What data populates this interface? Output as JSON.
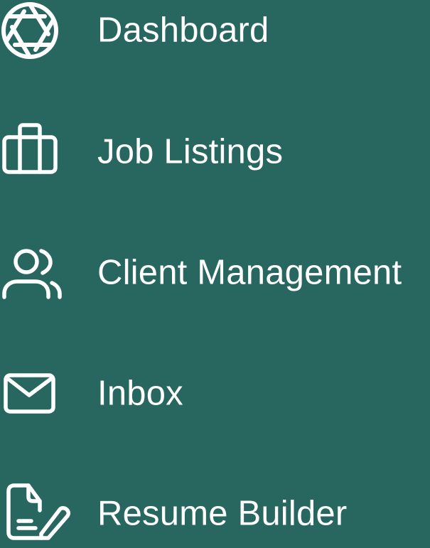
{
  "sidebar": {
    "background_color": "#286660",
    "text_color": "#ffffff",
    "items": [
      {
        "label": "Dashboard",
        "icon": "aperture-icon"
      },
      {
        "label": "Job Listings",
        "icon": "briefcase-icon"
      },
      {
        "label": "Client Management",
        "icon": "users-icon"
      },
      {
        "label": "Inbox",
        "icon": "mail-icon"
      },
      {
        "label": "Resume Builder",
        "icon": "file-edit-icon"
      }
    ]
  }
}
